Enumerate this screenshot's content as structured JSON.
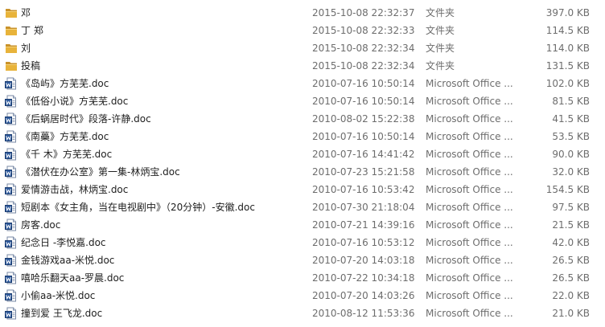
{
  "files": [
    {
      "name": "邓",
      "date": "2015-10-08 22:32:37",
      "type": "文件夹",
      "size": "397.0 KB",
      "icon": "folder-icon"
    },
    {
      "name": "丁  郑",
      "date": "2015-10-08 22:32:33",
      "type": "文件夹",
      "size": "114.5 KB",
      "icon": "folder-icon"
    },
    {
      "name": "刘",
      "date": "2015-10-08 22:32:34",
      "type": "文件夹",
      "size": "114.0 KB",
      "icon": "folder-icon"
    },
    {
      "name": "投稿",
      "date": "2015-10-08 22:32:34",
      "type": "文件夹",
      "size": "131.5 KB",
      "icon": "folder-icon"
    },
    {
      "name": "《岛屿》方芜芜.doc",
      "date": "2010-07-16 10:50:14",
      "type": "Microsoft Office ...",
      "size": "102.0 KB",
      "icon": "word-doc-icon"
    },
    {
      "name": "《低俗小说》方芜芜.doc",
      "date": "2010-07-16 10:50:14",
      "type": "Microsoft Office ...",
      "size": "81.5 KB",
      "icon": "word-doc-icon"
    },
    {
      "name": "《后蜗居时代》段落-许静.doc",
      "date": "2010-08-02 15:22:38",
      "type": "Microsoft Office ...",
      "size": "41.5 KB",
      "icon": "word-doc-icon"
    },
    {
      "name": "《南蘽》方芜芜.doc",
      "date": "2010-07-16 10:50:14",
      "type": "Microsoft Office ...",
      "size": "53.5 KB",
      "icon": "word-doc-icon"
    },
    {
      "name": "《千 木》方芜芜.doc",
      "date": "2010-07-16 14:41:42",
      "type": "Microsoft Office ...",
      "size": "90.0 KB",
      "icon": "word-doc-icon"
    },
    {
      "name": "《潜伏在办公室》第一集-林炳宝.doc",
      "date": "2010-07-23 15:21:58",
      "type": "Microsoft Office ...",
      "size": "32.0 KB",
      "icon": "word-doc-icon"
    },
    {
      "name": "爱情游击战，林炳宝.doc",
      "date": "2010-07-16 10:53:42",
      "type": "Microsoft Office ...",
      "size": "154.5 KB",
      "icon": "word-doc-icon"
    },
    {
      "name": "短剧本《女主角，当在电视剧中》（20分钟）-安徽.doc",
      "date": "2010-07-30 21:18:04",
      "type": "Microsoft Office ...",
      "size": "97.5 KB",
      "icon": "word-doc-icon"
    },
    {
      "name": "房客.doc",
      "date": "2010-07-21 14:39:16",
      "type": "Microsoft Office ...",
      "size": "21.5 KB",
      "icon": "word-doc-icon"
    },
    {
      "name": "纪念日 -李悦嘉.doc",
      "date": "2010-07-16 10:53:12",
      "type": "Microsoft Office ...",
      "size": "42.0 KB",
      "icon": "word-doc-icon"
    },
    {
      "name": "金钱游戏aa-米悦.doc",
      "date": "2010-07-20 14:03:18",
      "type": "Microsoft Office ...",
      "size": "26.5 KB",
      "icon": "word-doc-icon"
    },
    {
      "name": "嘻哈乐翻天aa-罗晨.doc",
      "date": "2010-07-22 10:34:18",
      "type": "Microsoft Office ...",
      "size": "26.5 KB",
      "icon": "word-doc-icon"
    },
    {
      "name": "小偷aa-米悦.doc",
      "date": "2010-07-20 14:03:26",
      "type": "Microsoft Office ...",
      "size": "22.0 KB",
      "icon": "word-doc-icon"
    },
    {
      "name": "撞到爱 王飞龙.doc",
      "date": "2010-08-12 11:53:36",
      "type": "Microsoft Office ...",
      "size": "21.0 KB",
      "icon": "word-doc-icon"
    }
  ],
  "colors": {
    "folder": "#e8b33a",
    "folder_dark": "#c9922a",
    "doc_blue": "#2b579a",
    "text": "#1e1e1e",
    "muted_text": "#6d6d6d"
  }
}
